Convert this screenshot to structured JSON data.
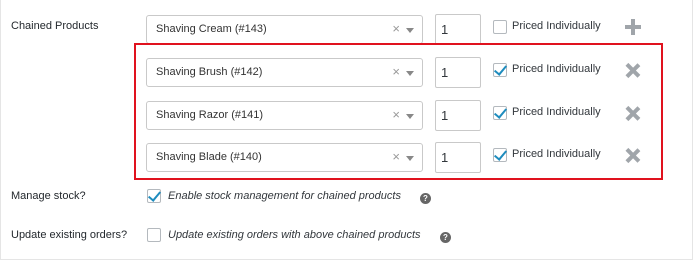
{
  "chained_products": {
    "label": "Chained Products",
    "rows": [
      {
        "product": "Shaving Cream (#143)",
        "qty": "1",
        "priced_label": "Priced Individually",
        "priced_checked": false,
        "action_icon": "plus-icon"
      },
      {
        "product": "Shaving Brush (#142)",
        "qty": "1",
        "priced_label": "Priced Individually",
        "priced_checked": true,
        "action_icon": "remove-icon"
      },
      {
        "product": "Shaving Razor (#141)",
        "qty": "1",
        "priced_label": "Priced Individually",
        "priced_checked": true,
        "action_icon": "remove-icon"
      },
      {
        "product": "Shaving Blade (#140)",
        "qty": "1",
        "priced_label": "Priced Individually",
        "priced_checked": true,
        "action_icon": "remove-icon"
      }
    ],
    "clear_glyph": "×"
  },
  "manage_stock": {
    "label": "Manage stock?",
    "checkbox_label": "Enable stock management for chained products",
    "checked": true,
    "help_glyph": "?"
  },
  "update_orders": {
    "label": "Update existing orders?",
    "checkbox_label": "Update existing orders with above chained products",
    "checked": false,
    "help_glyph": "?"
  },
  "colors": {
    "highlight": "#e0121e",
    "checkmark": "#1e8cbe",
    "icon_gray": "#a0a5aa"
  }
}
